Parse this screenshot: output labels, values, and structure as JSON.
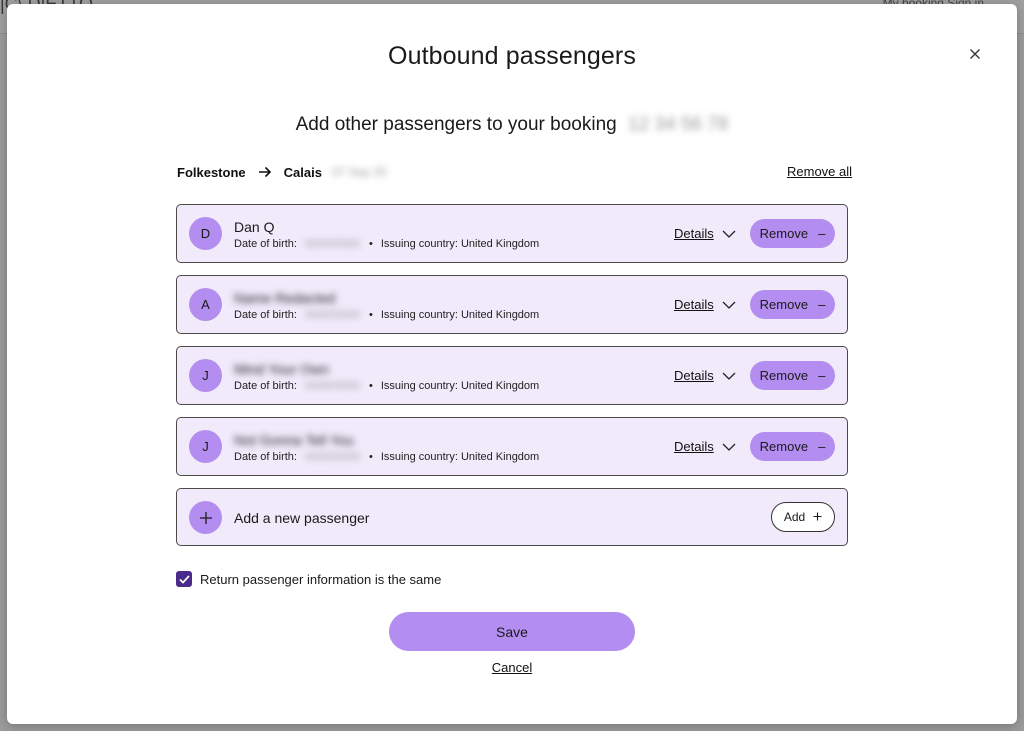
{
  "background": {
    "left_text": "|C\\  D|ETTO",
    "right_text": "My booking   Sign in"
  },
  "modal": {
    "title": "Outbound passengers",
    "subtitle": "Add other passengers to your booking",
    "booking_ref": "12 34 56 78"
  },
  "route": {
    "from": "Folkestone",
    "to": "Calais",
    "date": "07 Sep 25",
    "remove_all_label": "Remove all"
  },
  "labels": {
    "dob": "Date of birth:",
    "details": "Details",
    "remove": "Remove",
    "bullet": "•"
  },
  "passengers": [
    {
      "initial": "D",
      "name": "Dan Q",
      "dob": "00/00/0000",
      "country": "Issuing country: United Kingdom"
    },
    {
      "initial": "A",
      "name": "Name Redacted",
      "dob": "00/00/0000",
      "country": "Issuing country: United Kingdom"
    },
    {
      "initial": "J",
      "name": "Mind Your Own",
      "dob": "00/00/0000",
      "country": "Issuing country: United Kingdom"
    },
    {
      "initial": "J",
      "name": "Not Gonna Tell You",
      "dob": "00/00/0000",
      "country": "Issuing country: United Kingdom"
    }
  ],
  "add_passenger": {
    "label": "Add a new passenger",
    "button": "Add"
  },
  "return_same": {
    "label": "Return passenger information is the same",
    "checked": true
  },
  "actions": {
    "save": "Save",
    "cancel": "Cancel"
  },
  "colors": {
    "accent": "#b48df0",
    "card_bg": "#f1eafb",
    "checkbox": "#4a2a8a"
  }
}
